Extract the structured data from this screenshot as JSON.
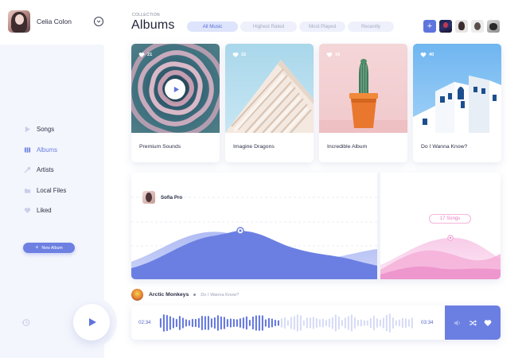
{
  "user": {
    "name": "Celia Colon"
  },
  "nav": {
    "items": [
      {
        "label": "Songs",
        "icon": "play-icon",
        "active": false
      },
      {
        "label": "Albums",
        "icon": "albums-icon",
        "active": true
      },
      {
        "label": "Artists",
        "icon": "microphone-icon",
        "active": false
      },
      {
        "label": "Local Files",
        "icon": "folder-icon",
        "active": false
      },
      {
        "label": "Liked",
        "icon": "heart-icon",
        "active": false
      }
    ],
    "new_album_label": "New Album"
  },
  "header": {
    "collection_label": "COLLECTION",
    "title": "Albums",
    "tabs": [
      {
        "label": "All Music",
        "active": true
      },
      {
        "label": "Highest Rated",
        "active": false
      },
      {
        "label": "Most Played",
        "active": false
      },
      {
        "label": "Recently",
        "active": false
      }
    ],
    "add_friend_label": "+"
  },
  "albums": [
    {
      "title": "Premium Sounds",
      "likes": "21"
    },
    {
      "title": "Imagine Dragons",
      "likes": "32"
    },
    {
      "title": "Incredible Album",
      "likes": "16"
    },
    {
      "title": "Do I Wanna Know?",
      "likes": "40"
    }
  ],
  "stats": {
    "listener": "Sofia Pro",
    "songs_badge": "17 Songs"
  },
  "player": {
    "artist": "Arctic Monkeys",
    "song": "Do I Wanna Know?",
    "elapsed": "02:34",
    "total": "03:34",
    "progress": 0.47
  },
  "colors": {
    "accent": "#6b7fe2",
    "pink": "#e87ac0",
    "sidebar_bg": "#f4f6fd"
  }
}
